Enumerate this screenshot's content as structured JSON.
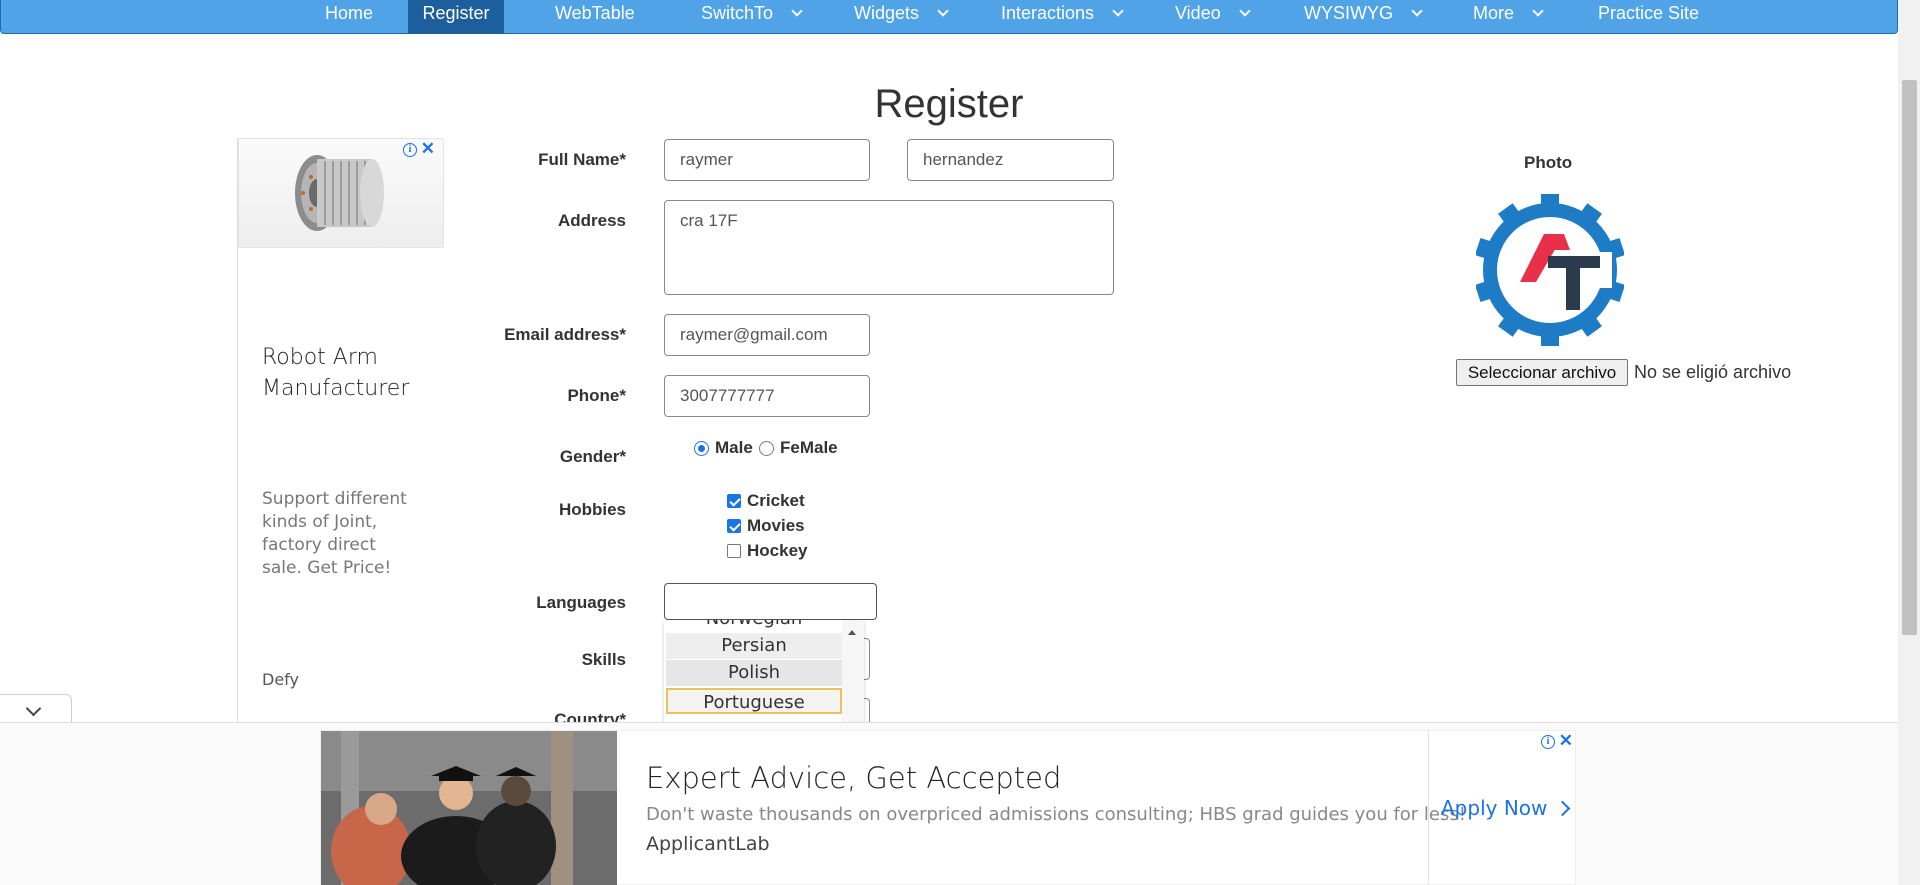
{
  "nav": {
    "items": [
      {
        "label": "Home"
      },
      {
        "label": "Register"
      },
      {
        "label": "WebTable"
      },
      {
        "label": "SwitchTo"
      },
      {
        "label": "Widgets"
      },
      {
        "label": "Interactions"
      },
      {
        "label": "Video"
      },
      {
        "label": "WYSIWYG"
      },
      {
        "label": "More"
      },
      {
        "label": "Practice Site"
      }
    ]
  },
  "page": {
    "title": "Register"
  },
  "left_ad": {
    "title": "Robot Arm Manufacturer",
    "description": "Support different kinds of Joint, factory direct sale. Get Price!",
    "brand": "Defy"
  },
  "form": {
    "full_name_label": "Full Name*",
    "first_name": "raymer",
    "last_name": "hernandez",
    "address_label": "Address",
    "address": "cra 17F",
    "email_label": "Email address*",
    "email": "raymer@gmail.com",
    "phone_label": "Phone*",
    "phone": "3007777777",
    "gender_label": "Gender*",
    "gender_options": [
      {
        "label": "Male",
        "checked": true
      },
      {
        "label": "FeMale",
        "checked": false
      }
    ],
    "hobbies_label": "Hobbies",
    "hobbies": [
      {
        "label": "Cricket",
        "checked": true
      },
      {
        "label": "Movies",
        "checked": true
      },
      {
        "label": "Hockey",
        "checked": false
      }
    ],
    "languages_label": "Languages",
    "languages_value": "",
    "language_options": [
      "Norwegian",
      "Persian",
      "Polish",
      "Portuguese"
    ],
    "language_focused": "Portuguese",
    "skills_label": "Skills",
    "country_label": "Country*"
  },
  "photo": {
    "label": "Photo",
    "file_button": "Seleccionar archivo",
    "file_status": "No se eligió archivo"
  },
  "bottom_ad": {
    "title": "Expert Advice, Get Accepted",
    "description": "Don't waste thousands on overpriced admissions consulting; HBS grad guides you for less!",
    "brand": "ApplicantLab",
    "cta": "Apply Now"
  },
  "colors": {
    "nav_bg": "#4fa3e6",
    "nav_active": "#1d5f9c",
    "accent": "#1a73e8",
    "logo_blue": "#1e7bc6",
    "logo_red": "#e8304a",
    "logo_dark": "#2b3a4d"
  }
}
